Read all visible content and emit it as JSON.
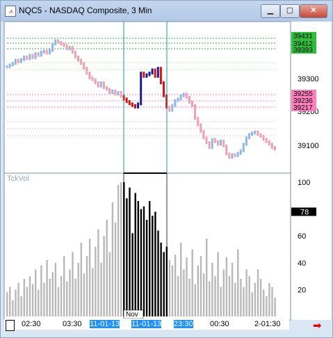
{
  "window": {
    "title": "NQC5 - NASDAQ Composite, 3 Min",
    "minimize": "▁",
    "maximize": "▢",
    "close": "✕"
  },
  "price_axis": {
    "ticks": [
      "39300",
      "39200",
      "39100"
    ]
  },
  "price_tags": [
    {
      "label": "39431",
      "color": "#2bbf3a"
    },
    {
      "label": "39412",
      "color": "#2bbf3a"
    },
    {
      "label": "39393",
      "color": "#2bbf3a"
    },
    {
      "label": "39255",
      "color": "#ff7fbf"
    },
    {
      "label": "39236",
      "color": "#ff7fbf"
    },
    {
      "label": "39217",
      "color": "#ff7fbf"
    }
  ],
  "volume_panel": {
    "name": "TckVol",
    "current": "78",
    "ticks": [
      "100",
      "80",
      "60",
      "40",
      "20"
    ],
    "month_marker": "Nov"
  },
  "time_axis": {
    "labels": [
      "02:30",
      "03:30",
      "11-01-13",
      "11-01-13",
      "23:30",
      "00:30",
      "2-01:30"
    ]
  },
  "chart_data": {
    "type": "bar",
    "price_ylim": [
      39040,
      39470
    ],
    "price_series": [
      39350,
      39355,
      39360,
      39370,
      39365,
      39372,
      39380,
      39375,
      39385,
      39378,
      39390,
      39385,
      39395,
      39398,
      39392,
      39400,
      39420,
      39430,
      39425,
      39420,
      39415,
      39405,
      39410,
      39395,
      39380,
      39370,
      39360,
      39345,
      39330,
      39315,
      39310,
      39300,
      39290,
      39300,
      39285,
      39280,
      39270,
      39275,
      39265,
      39270,
      39258,
      39250,
      39242,
      39235,
      39230,
      39225,
      39235,
      39330,
      39320,
      39325,
      39330,
      39340,
      39320,
      39345,
      39300,
      39260,
      39225,
      39215,
      39230,
      39245,
      39250,
      39260,
      39265,
      39255,
      39240,
      39230,
      39190,
      39170,
      39150,
      39130,
      39115,
      39100,
      39125,
      39118,
      39110,
      39120,
      39105,
      39080,
      39070,
      39078,
      39075,
      39082,
      39090,
      39110,
      39130,
      39140,
      39145,
      39148,
      39140,
      39135,
      39125,
      39118,
      39110,
      39100,
      39095
    ],
    "volume_ylim": [
      0,
      100
    ],
    "volume_series": [
      18,
      22,
      12,
      20,
      25,
      15,
      28,
      22,
      30,
      24,
      35,
      20,
      38,
      25,
      42,
      28,
      33,
      40,
      22,
      30,
      45,
      26,
      35,
      48,
      28,
      40,
      55,
      32,
      45,
      58,
      36,
      52,
      65,
      40,
      60,
      72,
      48,
      85,
      70,
      98,
      100,
      100,
      88,
      96,
      62,
      92,
      86,
      80,
      82,
      72,
      86,
      75,
      78,
      64,
      55,
      48,
      52,
      42,
      38,
      46,
      30,
      55,
      35,
      44,
      28,
      50,
      24,
      38,
      45,
      32,
      58,
      26,
      40,
      30,
      48,
      22,
      35,
      44,
      30,
      40,
      25,
      50,
      28,
      22,
      35,
      30,
      18,
      25,
      35,
      28,
      20,
      15,
      25,
      22,
      14
    ]
  }
}
